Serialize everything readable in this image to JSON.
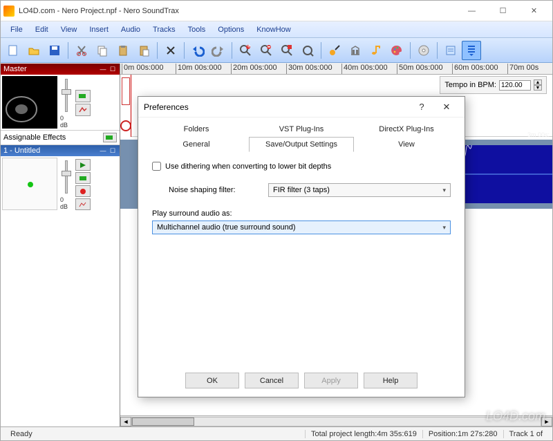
{
  "window": {
    "title": "LO4D.com - Nero Project.npf - Nero SoundTrax",
    "minimize": "—",
    "maximize": "☐",
    "close": "✕"
  },
  "menu": [
    "File",
    "Edit",
    "View",
    "Insert",
    "Audio",
    "Tracks",
    "Tools",
    "Options",
    "KnowHow"
  ],
  "toolbar_icons": [
    "new",
    "open",
    "save",
    "cut",
    "copy",
    "paste",
    "paste2",
    "delete",
    "undo",
    "redo",
    "zoom-in",
    "zoom-out",
    "zoom-sel",
    "zoom-fit",
    "fx",
    "library",
    "note",
    "palette",
    "cd",
    "props",
    "more"
  ],
  "master": {
    "title": "Master",
    "db": "0 dB"
  },
  "assignable": {
    "label": "Assignable Effects"
  },
  "track1": {
    "title": "1 - Untitled",
    "db": "0 dB"
  },
  "ruler": [
    "0m 00s:000",
    "10m 00s:000",
    "20m 00s:000",
    "30m 00s:000",
    "40m 00s:000",
    "50m 00s:000",
    "60m 00s:000",
    "70m 00s"
  ],
  "tempo": {
    "label": "Tempo in BPM:",
    "value": "120.00"
  },
  "wave": {
    "end_label": "3m 00s:"
  },
  "status": {
    "ready": "Ready",
    "total": "Total project length:4m 35s:619",
    "position": "Position:1m 27s:280",
    "track": "Track 1 of"
  },
  "dialog": {
    "title": "Preferences",
    "help": "?",
    "close": "✕",
    "tabs_row1": [
      "Folders",
      "VST Plug-Ins",
      "DirectX Plug-Ins"
    ],
    "tabs_row2": [
      "General",
      "Save/Output Settings",
      "View"
    ],
    "active_tab": "Save/Output Settings",
    "dither_label": "Use dithering when converting to lower bit depths",
    "noise_label": "Noise shaping filter:",
    "noise_value": "FIR filter (3 taps)",
    "surround_label": "Play surround audio as:",
    "surround_value": "Multichannel audio (true surround sound)",
    "buttons": {
      "ok": "OK",
      "cancel": "Cancel",
      "apply": "Apply",
      "help": "Help"
    }
  },
  "watermark": "LO4D.com"
}
